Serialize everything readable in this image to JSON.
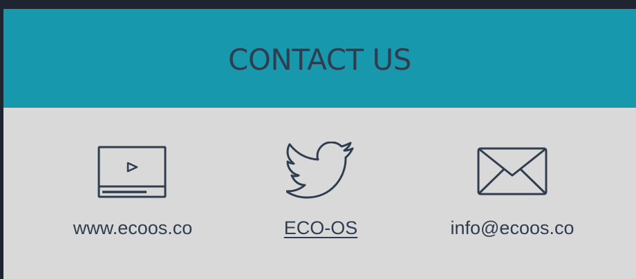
{
  "header": {
    "title": "CONTACT US"
  },
  "colors": {
    "page_background": "#1f2530",
    "header_background": "#1898ad",
    "panel_background": "#d9d9d9",
    "text": "#2f3d4e"
  },
  "contacts": [
    {
      "icon": "video-player-icon",
      "label": "www.ecoos.co"
    },
    {
      "icon": "twitter-bird-icon",
      "label": "ECO-OS"
    },
    {
      "icon": "envelope-icon",
      "label": "info@ecoos.co"
    }
  ]
}
